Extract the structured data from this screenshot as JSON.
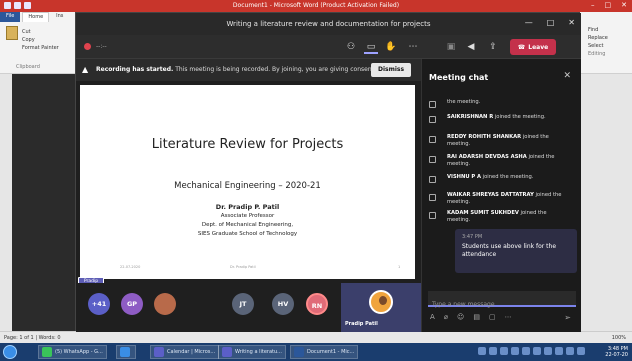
{
  "word": {
    "window_title": "Document1 - Microsoft Word (Product Activation Failed)",
    "tabs": [
      "File",
      "Home",
      "Ins"
    ],
    "clipboard": {
      "paste": "Paste",
      "cut": "Cut",
      "copy": "Copy",
      "format_painter": "Format Painter",
      "label": "Clipboard"
    },
    "editing": {
      "find": "Find",
      "replace": "Replace",
      "select": "Select",
      "label": "Editing"
    },
    "status_left": "Page: 1 of 1  |  Words: 0",
    "zoom": "100%"
  },
  "teams": {
    "window_title": "Writing a literature review and documentation for projects",
    "timer": "--:--",
    "leave_label": "Leave",
    "banner_title": "Recording has started.",
    "banner_text": "This meeting is being recorded. By joining, you are giving consent for...",
    "dismiss_label": "Dismiss",
    "slide": {
      "title": "Literature Review for Projects",
      "subtitle": "Mechanical Engineering – 2020-21",
      "name": "Dr. Pradip P. Patil",
      "role": "Associate Professor",
      "dept": "Dept. of Mechanical Engineering,",
      "college": "SIES Graduate School of Technology",
      "footer_left": "22-07-2020",
      "footer_mid": "Dr. Pradip Patil",
      "footer_right": "1"
    },
    "presenter_tag": "Pradip Patil",
    "participants": [
      {
        "label": "+41",
        "color": "#5b5fc7"
      },
      {
        "label": "GP",
        "color": "#8e5cc4"
      },
      {
        "label": "",
        "color": "#b86a4a"
      },
      {
        "label": "JT",
        "color": "#5a6478"
      },
      {
        "label": "HV",
        "color": "#5a6478"
      },
      {
        "label": "RN",
        "color": "#e06b78"
      }
    ],
    "self_name": "Pradip Patil",
    "chat": {
      "title": "Meeting chat",
      "events": [
        {
          "name": "",
          "text": "the meeting."
        },
        {
          "name": "SAIKRISHNAN R",
          "text": "joined the meeting."
        },
        {
          "name": "REDDY ROHITH SHANKAR",
          "text": "joined the meeting."
        },
        {
          "name": "RAI ADARSH DEVDAS ASHA",
          "text": "joined the meeting."
        },
        {
          "name": "VISHNU P A",
          "text": "joined the meeting."
        },
        {
          "name": "WAIKAR SHREYAS DATTATRAY",
          "text": "joined the meeting."
        },
        {
          "name": "KADAM SUMIT SUKHDEV",
          "text": "joined the meeting."
        }
      ],
      "message_time": "3:47 PM",
      "message_text": "Students use above link for the attendance",
      "compose_placeholder": "Type a new message"
    }
  },
  "taskbar": {
    "items": [
      "(5) WhatsApp - G...",
      "Calendar | Micros...",
      "Writing a literatu...",
      "Document1 - Mic..."
    ],
    "time": "3:48 PM",
    "date": "22-07-20"
  }
}
